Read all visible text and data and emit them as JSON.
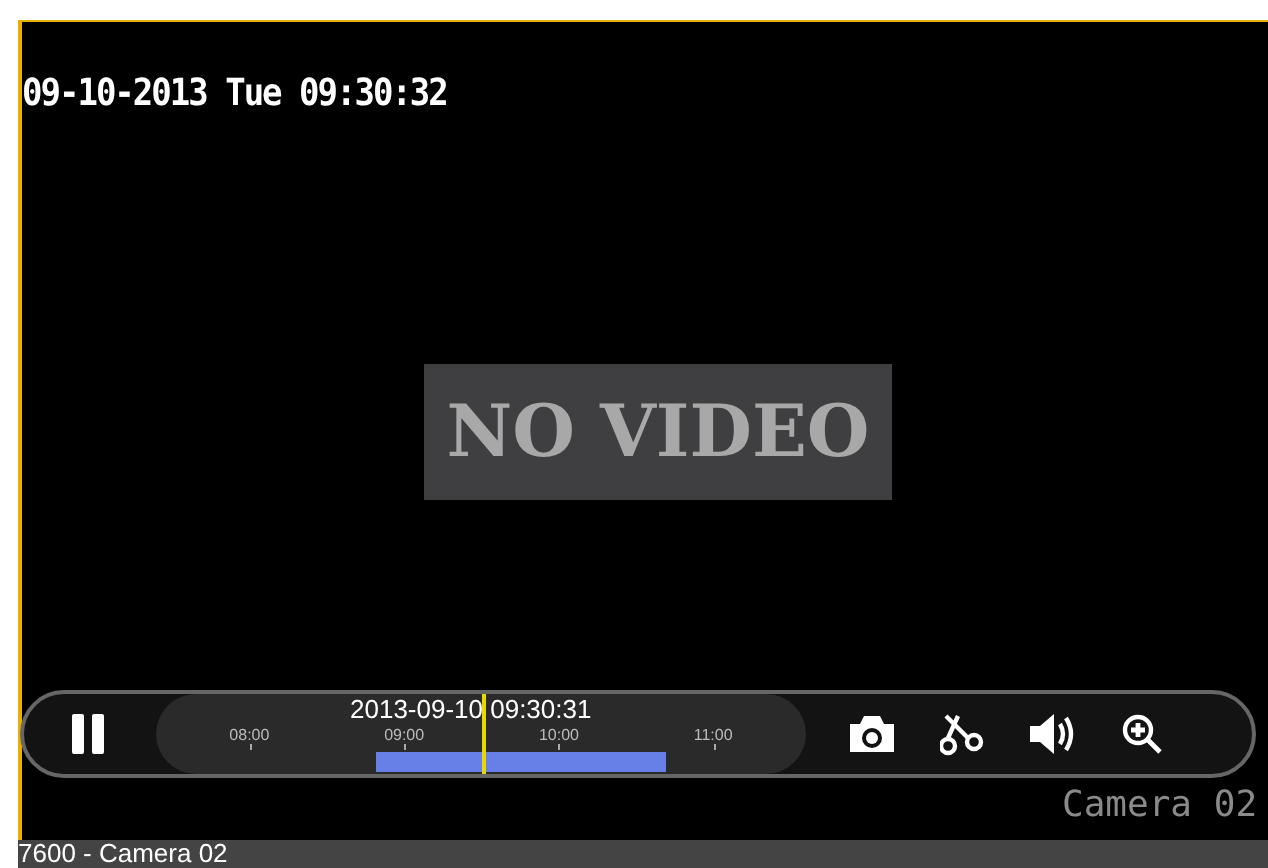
{
  "video": {
    "osd_datetime": "09-10-2013 Tue 09:30:32",
    "status": "NO VIDEO",
    "osd_camera": "Camera 02"
  },
  "controls": {
    "playing": true,
    "timeline": {
      "timestamp": "2013-09-10 09:30:31",
      "level": 0.5,
      "ticks": [
        "08:00",
        "09:00",
        "10:00",
        "11:00"
      ]
    },
    "tools": [
      {
        "kind": "snapshot"
      },
      {
        "kind": "clip"
      },
      {
        "kind": "volume"
      },
      {
        "kind": "zoom"
      }
    ]
  },
  "status_bar": {
    "label": "7600 - Camera 02"
  }
}
